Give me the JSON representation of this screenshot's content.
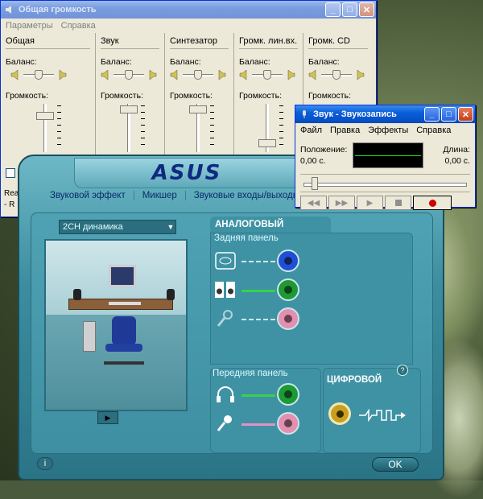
{
  "volume_window": {
    "title": "Общая громкость",
    "menu": [
      "Параметры",
      "Справка"
    ],
    "columns": [
      {
        "header": "Общая",
        "balance_label": "Баланс:",
        "volume_label": "Громкость:"
      },
      {
        "header": "Звук",
        "balance_label": "Баланс:",
        "volume_label": "Громкость:"
      },
      {
        "header": "Синтезатор",
        "balance_label": "Баланс:",
        "volume_label": "Громкость:"
      },
      {
        "header": "Громк. лин.вх.",
        "balance_label": "Баланс:",
        "volume_label": "Громкость:"
      },
      {
        "header": "Громк. CD",
        "balance_label": "Баланс:",
        "volume_label": "Громкость:"
      }
    ],
    "partial_text_1": "Real",
    "partial_text_2": "- R"
  },
  "record_window": {
    "title": "Звук - Звукозапись",
    "menu": [
      "Файл",
      "Правка",
      "Эффекты",
      "Справка"
    ],
    "position_label": "Положение:",
    "position_value": "0,00 с.",
    "length_label": "Длина:",
    "length_value": "0,00 с.",
    "buttons": [
      "◀◀",
      "▶▶",
      "▶",
      "■",
      "●"
    ]
  },
  "asus_window": {
    "logo": "ASUS",
    "tabs": [
      "Звуковой эффект",
      "Микшер",
      "Звуковые входы/выходы"
    ],
    "speaker_config": "2CH динамика",
    "analog_title": "АНАЛОГОВЫЙ",
    "rear_panel": "Задняя панель",
    "front_panel": "Передняя панель",
    "digital_title": "ЦИФРОВОЙ",
    "ok_label": "OK",
    "info_label": "i",
    "help_label": "?",
    "colors": {
      "jack_blue": "#1f4fd6",
      "jack_green": "#1d9a35",
      "jack_pink": "#e38fb0",
      "coax_gold": "#c8a020"
    }
  }
}
